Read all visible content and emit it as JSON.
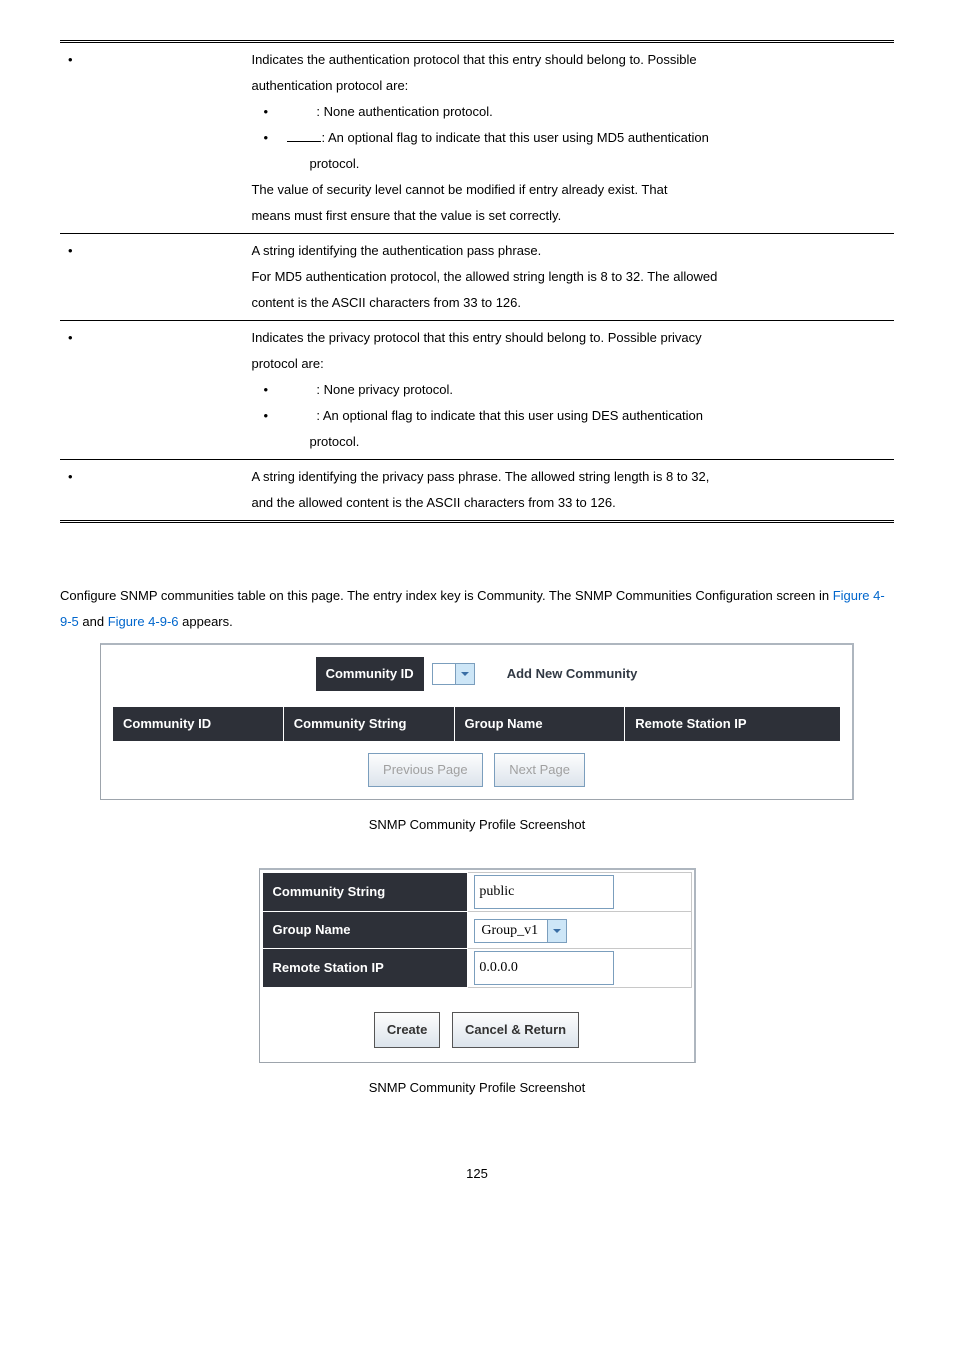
{
  "table": {
    "r1": {
      "l1": "Indicates the authentication protocol that this entry should belong to. Possible",
      "l2": "authentication protocol are:",
      "b1": ": None authentication protocol.",
      "b2": ": An optional flag to indicate that this user using MD5 authentication",
      "b2b": "protocol.",
      "l3": "The value of security level cannot be modified if entry already exist. That",
      "l4": "means must first ensure that the value is set correctly."
    },
    "r2": {
      "l1": "A string identifying the authentication pass phrase.",
      "l2": "For MD5 authentication protocol, the allowed string length is 8 to 32. The allowed",
      "l3": "content is the ASCII characters from 33 to 126."
    },
    "r3": {
      "l1": "Indicates the privacy protocol that this entry should belong to. Possible privacy",
      "l2": "protocol are:",
      "b1": ": None privacy protocol.",
      "b2": ": An optional flag to indicate that this user using DES authentication",
      "b2b": "protocol."
    },
    "r4": {
      "l1": "A string identifying the privacy pass phrase. The allowed string length is 8 to 32,",
      "l2": "and the allowed content is the ASCII characters from 33 to 126."
    }
  },
  "body": {
    "p1a": "Configure SNMP communities table on this page. The entry index key is Community. The SNMP Communities Configuration",
    "p1b": "screen in ",
    "link1": "Figure 4-9-5",
    "mid": " and ",
    "link2": "Figure 4-9-6",
    "end": " appears."
  },
  "fig1": {
    "commid": "Community ID",
    "addnew": "Add New Community",
    "h1": "Community ID",
    "h2": "Community String",
    "h3": "Group Name",
    "h4": "Remote Station IP",
    "prev": "Previous Page",
    "next": "Next Page",
    "caption": "SNMP Community Profile Screenshot"
  },
  "fig2": {
    "r1": "Community String",
    "v1": "public",
    "r2": "Group Name",
    "v2": "Group_v1",
    "r3": "Remote Station IP",
    "v3": "0.0.0.0",
    "create": "Create",
    "cancel": "Cancel & Return",
    "caption": "SNMP Community Profile Screenshot"
  },
  "page": "125"
}
